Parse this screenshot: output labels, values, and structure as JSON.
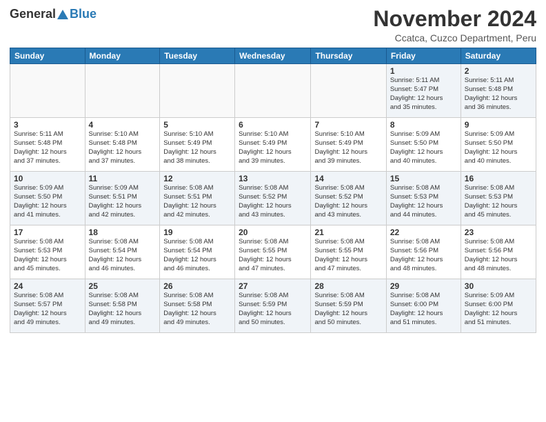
{
  "logo": {
    "general": "General",
    "blue": "Blue"
  },
  "title": {
    "month_year": "November 2024",
    "location": "Ccatca, Cuzco Department, Peru"
  },
  "weekdays": [
    "Sunday",
    "Monday",
    "Tuesday",
    "Wednesday",
    "Thursday",
    "Friday",
    "Saturday"
  ],
  "weeks": [
    [
      {
        "day": "",
        "info": ""
      },
      {
        "day": "",
        "info": ""
      },
      {
        "day": "",
        "info": ""
      },
      {
        "day": "",
        "info": ""
      },
      {
        "day": "",
        "info": ""
      },
      {
        "day": "1",
        "info": "Sunrise: 5:11 AM\nSunset: 5:47 PM\nDaylight: 12 hours\nand 35 minutes."
      },
      {
        "day": "2",
        "info": "Sunrise: 5:11 AM\nSunset: 5:48 PM\nDaylight: 12 hours\nand 36 minutes."
      }
    ],
    [
      {
        "day": "3",
        "info": "Sunrise: 5:11 AM\nSunset: 5:48 PM\nDaylight: 12 hours\nand 37 minutes."
      },
      {
        "day": "4",
        "info": "Sunrise: 5:10 AM\nSunset: 5:48 PM\nDaylight: 12 hours\nand 37 minutes."
      },
      {
        "day": "5",
        "info": "Sunrise: 5:10 AM\nSunset: 5:49 PM\nDaylight: 12 hours\nand 38 minutes."
      },
      {
        "day": "6",
        "info": "Sunrise: 5:10 AM\nSunset: 5:49 PM\nDaylight: 12 hours\nand 39 minutes."
      },
      {
        "day": "7",
        "info": "Sunrise: 5:10 AM\nSunset: 5:49 PM\nDaylight: 12 hours\nand 39 minutes."
      },
      {
        "day": "8",
        "info": "Sunrise: 5:09 AM\nSunset: 5:50 PM\nDaylight: 12 hours\nand 40 minutes."
      },
      {
        "day": "9",
        "info": "Sunrise: 5:09 AM\nSunset: 5:50 PM\nDaylight: 12 hours\nand 40 minutes."
      }
    ],
    [
      {
        "day": "10",
        "info": "Sunrise: 5:09 AM\nSunset: 5:50 PM\nDaylight: 12 hours\nand 41 minutes."
      },
      {
        "day": "11",
        "info": "Sunrise: 5:09 AM\nSunset: 5:51 PM\nDaylight: 12 hours\nand 42 minutes."
      },
      {
        "day": "12",
        "info": "Sunrise: 5:08 AM\nSunset: 5:51 PM\nDaylight: 12 hours\nand 42 minutes."
      },
      {
        "day": "13",
        "info": "Sunrise: 5:08 AM\nSunset: 5:52 PM\nDaylight: 12 hours\nand 43 minutes."
      },
      {
        "day": "14",
        "info": "Sunrise: 5:08 AM\nSunset: 5:52 PM\nDaylight: 12 hours\nand 43 minutes."
      },
      {
        "day": "15",
        "info": "Sunrise: 5:08 AM\nSunset: 5:53 PM\nDaylight: 12 hours\nand 44 minutes."
      },
      {
        "day": "16",
        "info": "Sunrise: 5:08 AM\nSunset: 5:53 PM\nDaylight: 12 hours\nand 45 minutes."
      }
    ],
    [
      {
        "day": "17",
        "info": "Sunrise: 5:08 AM\nSunset: 5:53 PM\nDaylight: 12 hours\nand 45 minutes."
      },
      {
        "day": "18",
        "info": "Sunrise: 5:08 AM\nSunset: 5:54 PM\nDaylight: 12 hours\nand 46 minutes."
      },
      {
        "day": "19",
        "info": "Sunrise: 5:08 AM\nSunset: 5:54 PM\nDaylight: 12 hours\nand 46 minutes."
      },
      {
        "day": "20",
        "info": "Sunrise: 5:08 AM\nSunset: 5:55 PM\nDaylight: 12 hours\nand 47 minutes."
      },
      {
        "day": "21",
        "info": "Sunrise: 5:08 AM\nSunset: 5:55 PM\nDaylight: 12 hours\nand 47 minutes."
      },
      {
        "day": "22",
        "info": "Sunrise: 5:08 AM\nSunset: 5:56 PM\nDaylight: 12 hours\nand 48 minutes."
      },
      {
        "day": "23",
        "info": "Sunrise: 5:08 AM\nSunset: 5:56 PM\nDaylight: 12 hours\nand 48 minutes."
      }
    ],
    [
      {
        "day": "24",
        "info": "Sunrise: 5:08 AM\nSunset: 5:57 PM\nDaylight: 12 hours\nand 49 minutes."
      },
      {
        "day": "25",
        "info": "Sunrise: 5:08 AM\nSunset: 5:58 PM\nDaylight: 12 hours\nand 49 minutes."
      },
      {
        "day": "26",
        "info": "Sunrise: 5:08 AM\nSunset: 5:58 PM\nDaylight: 12 hours\nand 49 minutes."
      },
      {
        "day": "27",
        "info": "Sunrise: 5:08 AM\nSunset: 5:59 PM\nDaylight: 12 hours\nand 50 minutes."
      },
      {
        "day": "28",
        "info": "Sunrise: 5:08 AM\nSunset: 5:59 PM\nDaylight: 12 hours\nand 50 minutes."
      },
      {
        "day": "29",
        "info": "Sunrise: 5:08 AM\nSunset: 6:00 PM\nDaylight: 12 hours\nand 51 minutes."
      },
      {
        "day": "30",
        "info": "Sunrise: 5:09 AM\nSunset: 6:00 PM\nDaylight: 12 hours\nand 51 minutes."
      }
    ]
  ]
}
